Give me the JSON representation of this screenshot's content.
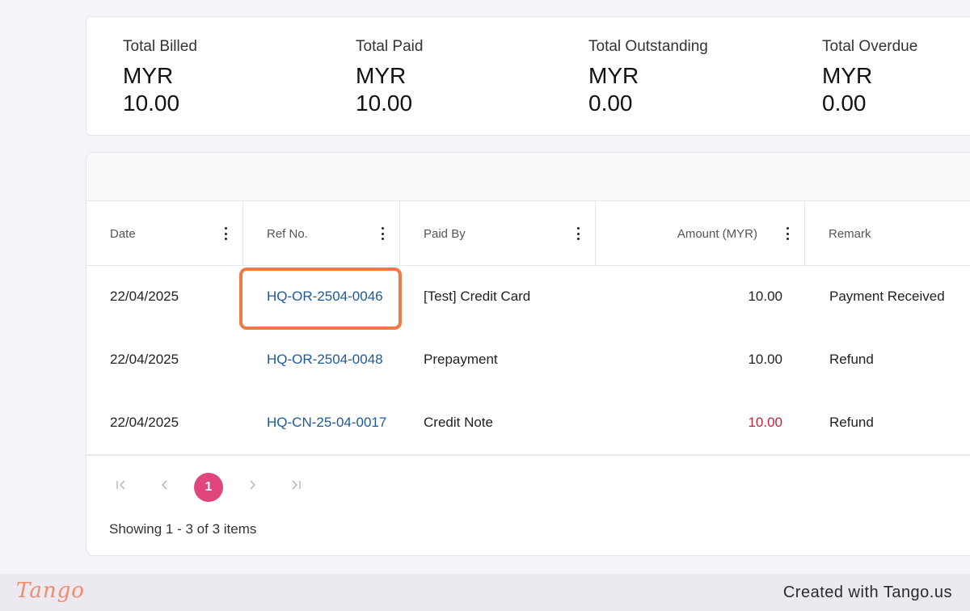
{
  "summary": {
    "items": [
      {
        "label": "Total Billed",
        "currency": "MYR",
        "value": "10.00"
      },
      {
        "label": "Total Paid",
        "currency": "MYR",
        "value": "10.00"
      },
      {
        "label": "Total Outstanding",
        "currency": "MYR",
        "value": "0.00"
      },
      {
        "label": "Total Overdue",
        "currency": "MYR",
        "value": "0.00"
      }
    ]
  },
  "table": {
    "columns": [
      "Date",
      "Ref No.",
      "Paid By",
      "Amount (MYR)",
      "Remark"
    ],
    "rows": [
      {
        "date": "22/04/2025",
        "ref": "HQ-OR-2504-0046",
        "paid_by": "[Test] Credit Card",
        "amount": "10.00",
        "remark": "Payment Received"
      },
      {
        "date": "22/04/2025",
        "ref": "HQ-OR-2504-0048",
        "paid_by": "Prepayment",
        "amount": "10.00",
        "remark": "Refund"
      },
      {
        "date": "22/04/2025",
        "ref": "HQ-CN-25-04-0017",
        "paid_by": "Credit Note",
        "amount": "10.00",
        "remark": "Refund"
      }
    ]
  },
  "pagination": {
    "first_icon": "first-page-icon",
    "prev_icon": "chevron-left-icon",
    "current_page": "1",
    "next_icon": "chevron-right-icon",
    "last_icon": "last-page-icon",
    "showing_text": "Showing 1 - 3 of 3 items"
  },
  "colors": {
    "link": "#1c5a9c",
    "negative_amount": "#c8203a",
    "active_page": "#e0457b",
    "highlight": "#f07a45"
  },
  "footer": {
    "logo_text": "Tango",
    "credit": "Created with Tango.us"
  }
}
